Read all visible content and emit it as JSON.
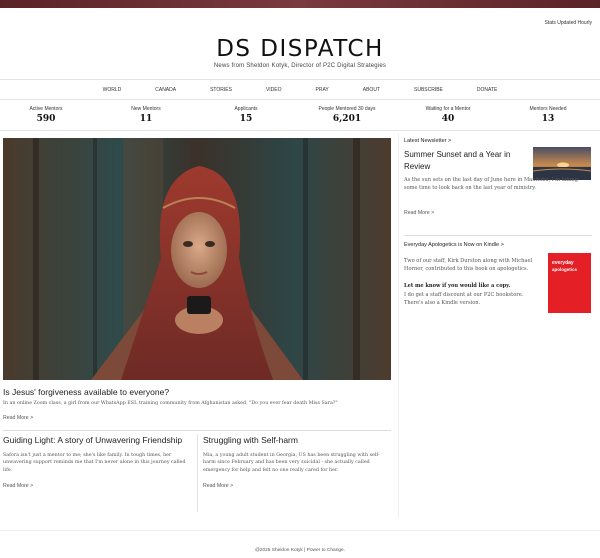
{
  "header": {
    "stats_updated": "Stats Updated Hourly",
    "site_title": "DS DISPATCH",
    "tagline": "News from Sheldon Kotyk, Director of P2C Digital Strategies"
  },
  "nav": {
    "items": [
      {
        "label": "WORLD"
      },
      {
        "label": "CANADA"
      },
      {
        "label": "STORIES"
      },
      {
        "label": "VIDEO"
      },
      {
        "label": "PRAY"
      },
      {
        "label": "ABOUT"
      },
      {
        "label": "SUBSCRIBE"
      },
      {
        "label": "DONATE"
      }
    ]
  },
  "stats": [
    {
      "label": "Active Mentors",
      "value": "590"
    },
    {
      "label": "New Mentors",
      "value": "11"
    },
    {
      "label": "Applicants",
      "value": "15"
    },
    {
      "label": "People Mentored 30 days",
      "value": "6,201"
    },
    {
      "label": "Waiting for a Mentor",
      "value": "40"
    },
    {
      "label": "Mentors Needed",
      "value": "13"
    }
  ],
  "main": {
    "headline": "Is Jesus' forgiveness available to everyone?",
    "excerpt": "In an online Zoom class, a girl from our WhatsApp ESL training community from Afghanistan asked, \"Do you ever fear death Miss Sara?\"",
    "read_more": "Read More >"
  },
  "stories": [
    {
      "title": "Guiding Light: A story of Unwavering Friendship",
      "excerpt": "Safora isn't just a mentor to me; she's like family. In tough times, her unwavering support reminds me that I'm never alone in this journey called life.",
      "read_more": "Read More >"
    },
    {
      "title": "Struggling with Self-harm",
      "excerpt": "Mia, a young adult student in Georgia, US has been struggling with self-harm since February and has been very suicidal - she actually called emergency for help and felt no one really cared for her.",
      "read_more": "Read More >"
    }
  ],
  "sidebar": {
    "newsletter": {
      "heading": "Latest Newsletter >",
      "title": "Summer Sunset and a Year in Review",
      "excerpt": "As the sun sets on the last day of June here in Manitoba, I'm taking some time to look back on the last year of ministry.",
      "read_more": "Read More >"
    },
    "book": {
      "heading": "Everyday Apologetics is Now on Kindle >",
      "para1": "Two of our staff, Kirk Durston along with Michael Horner, contributed to this book on apologetics.",
      "para2_bold": "Let me know if you would like a copy.",
      "para2": "I do get a staff discount at our P2C bookstore. There's also a Kindle version.",
      "cover_line1": "everyday",
      "cover_line2": "apologetics"
    }
  },
  "footer": {
    "text": "@2025 Sheldon Kotyk | Power to Change."
  },
  "colors": {
    "topbar": "#5a2328",
    "book_cover": "#e41f26"
  }
}
